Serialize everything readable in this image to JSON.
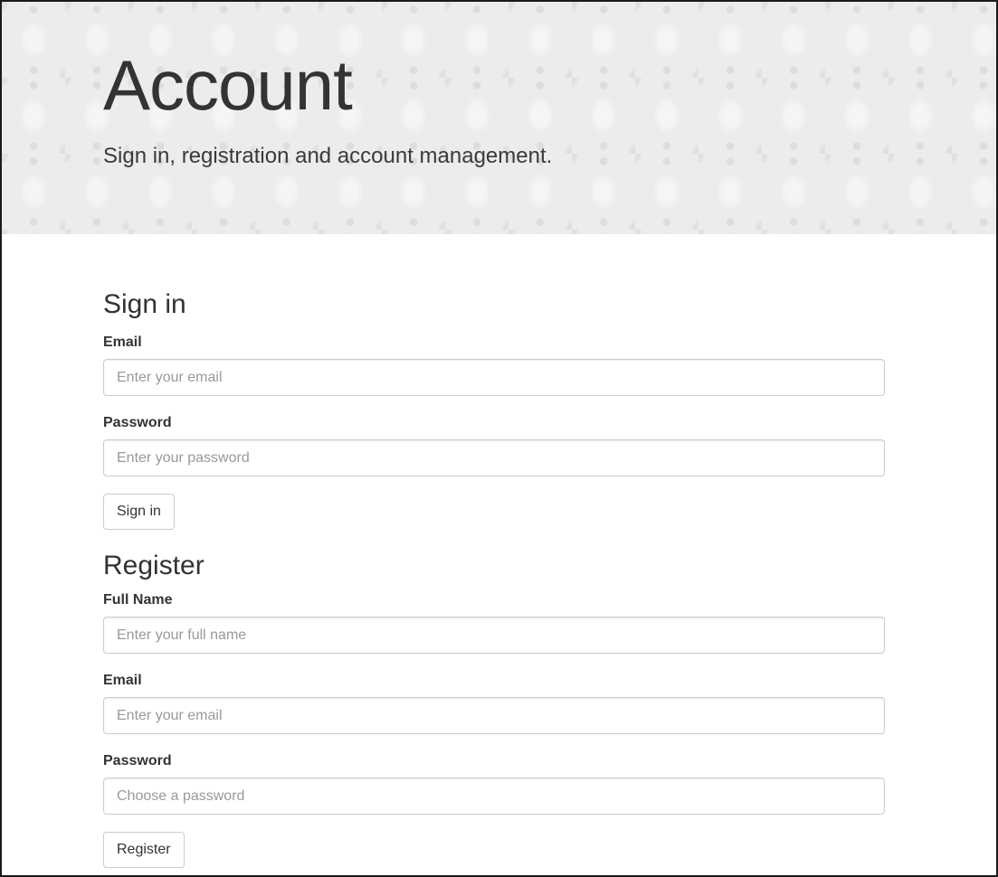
{
  "header": {
    "title": "Account",
    "subtitle": "Sign in, registration and account management."
  },
  "signin": {
    "title": "Sign in",
    "email_label": "Email",
    "email_placeholder": "Enter your email",
    "email_value": "",
    "password_label": "Password",
    "password_placeholder": "Enter your password",
    "password_value": "",
    "button_label": "Sign in"
  },
  "register": {
    "title": "Register",
    "fullname_label": "Full Name",
    "fullname_placeholder": "Enter your full name",
    "fullname_value": "",
    "email_label": "Email",
    "email_placeholder": "Enter your email",
    "email_value": "",
    "password_label": "Password",
    "password_placeholder": "Choose a password",
    "password_value": "",
    "button_label": "Register"
  },
  "colors": {
    "header_background": "#ececec",
    "text": "#333333",
    "input_border": "#cccccc",
    "placeholder": "#999999"
  }
}
